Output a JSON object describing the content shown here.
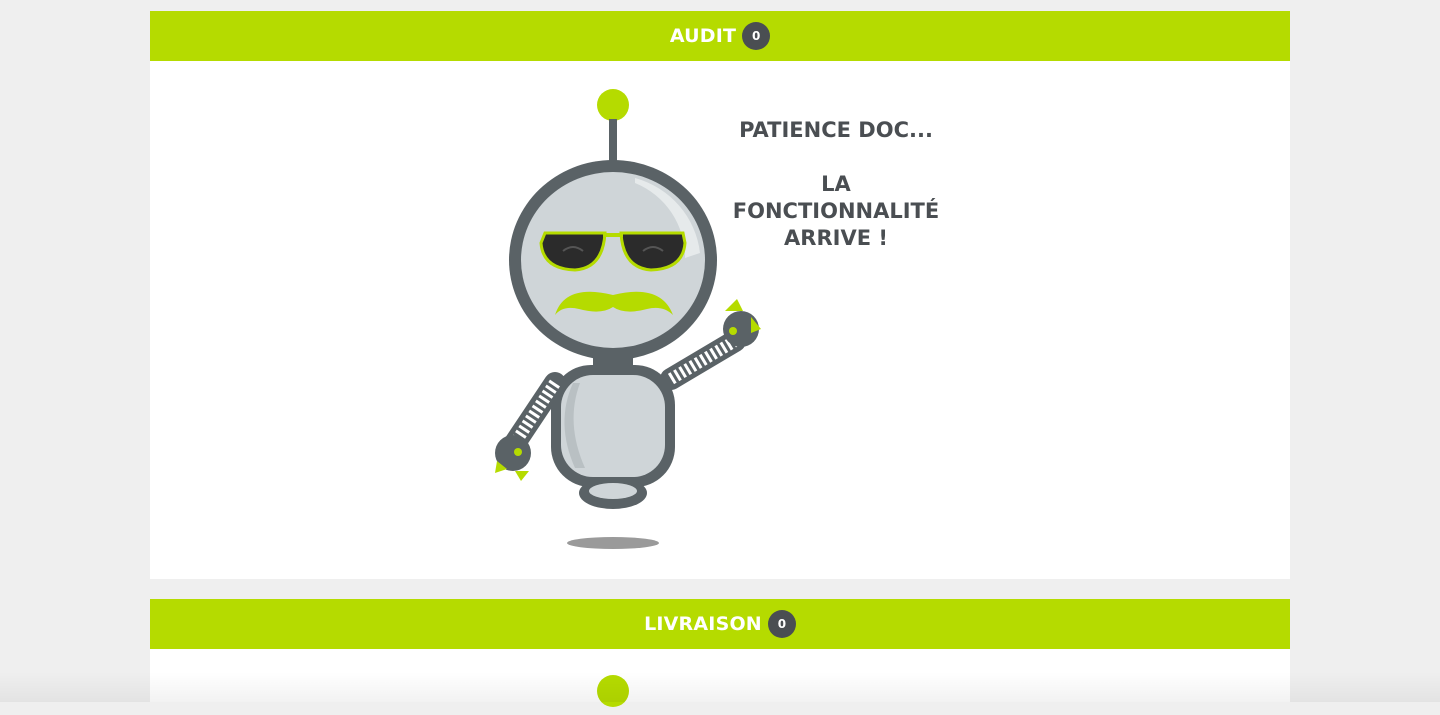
{
  "sections": [
    {
      "title": "AUDIT",
      "count": "0",
      "message": {
        "line1": "PATIENCE DOC...",
        "line2": "LA FONCTIONNALITÉ ARRIVE !"
      }
    },
    {
      "title": "LIVRAISON",
      "count": "0"
    }
  ],
  "colors": {
    "accent": "#b5db00",
    "badge": "#4a4e52",
    "robot_body": "#5a6266",
    "robot_fill": "#cfd5d8"
  },
  "illustration": "robot-mascot-with-sunglasses-and-mustache"
}
